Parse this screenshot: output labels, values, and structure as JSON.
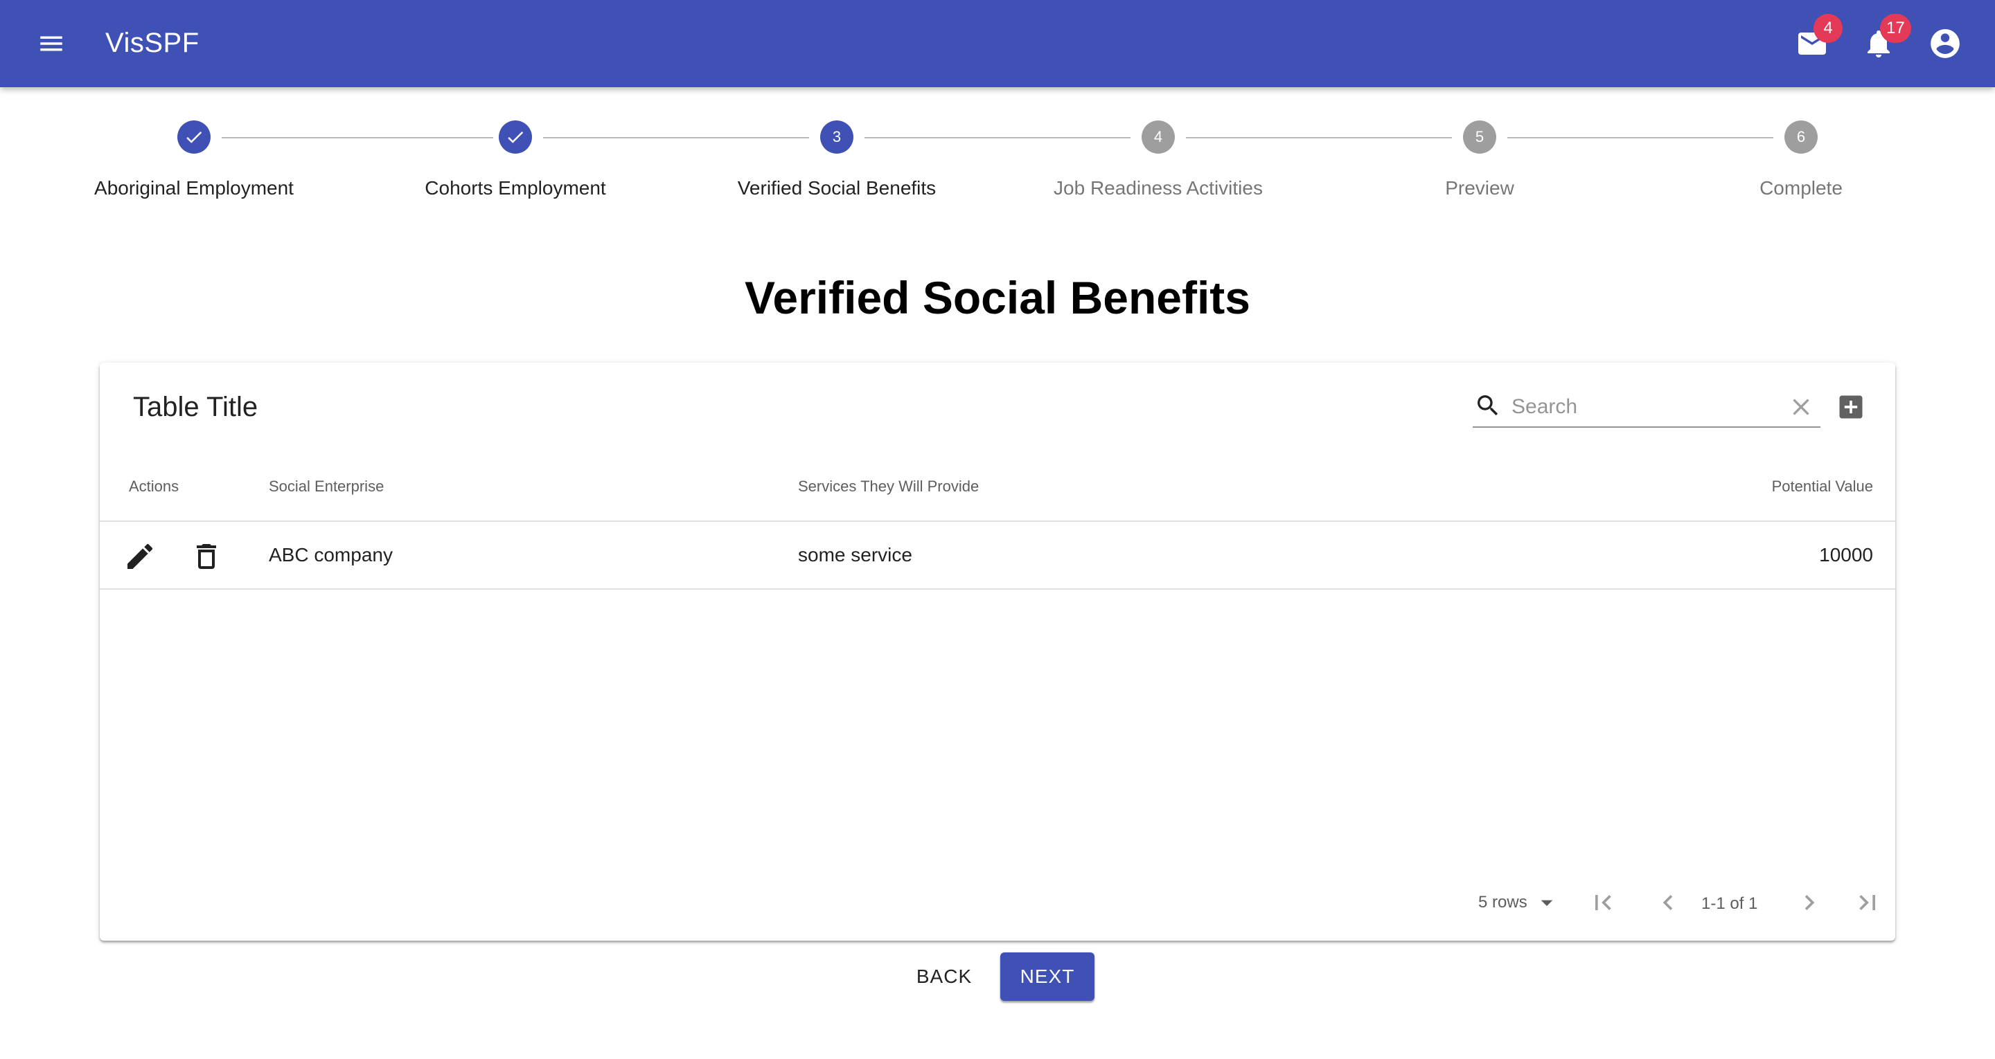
{
  "appbar": {
    "title": "VisSPF",
    "mail_badge": "4",
    "notifications_badge": "17",
    "color": "#3f51b5",
    "icons": [
      "menu-icon",
      "mail-icon",
      "bell-icon",
      "account-circle-icon"
    ]
  },
  "stepper": {
    "steps": [
      {
        "label": "Aboriginal Employment",
        "number": "1",
        "state": "done"
      },
      {
        "label": "Cohorts Employment",
        "number": "2",
        "state": "done"
      },
      {
        "label": "Verified Social Benefits",
        "number": "3",
        "state": "active"
      },
      {
        "label": "Job Readiness Activities",
        "number": "4",
        "state": "todo"
      },
      {
        "label": "Preview",
        "number": "5",
        "state": "todo"
      },
      {
        "label": "Complete",
        "number": "6",
        "state": "todo"
      }
    ]
  },
  "page": {
    "title": "Verified Social Benefits"
  },
  "table": {
    "title": "Table Title",
    "search_placeholder": "Search",
    "search_value": "",
    "columns": [
      "Actions",
      "Social Enterprise",
      "Services They Will Provide",
      "Potential Value"
    ],
    "rows": [
      {
        "social_enterprise": "ABC company",
        "services": "some service",
        "potential_value": "10000"
      }
    ],
    "row_actions": [
      "edit-icon",
      "delete-icon"
    ],
    "pagination": {
      "rows_per_page": "5 rows",
      "page_info": "1-1 of 1"
    }
  },
  "buttons": {
    "back": "Back",
    "next": "Next"
  }
}
